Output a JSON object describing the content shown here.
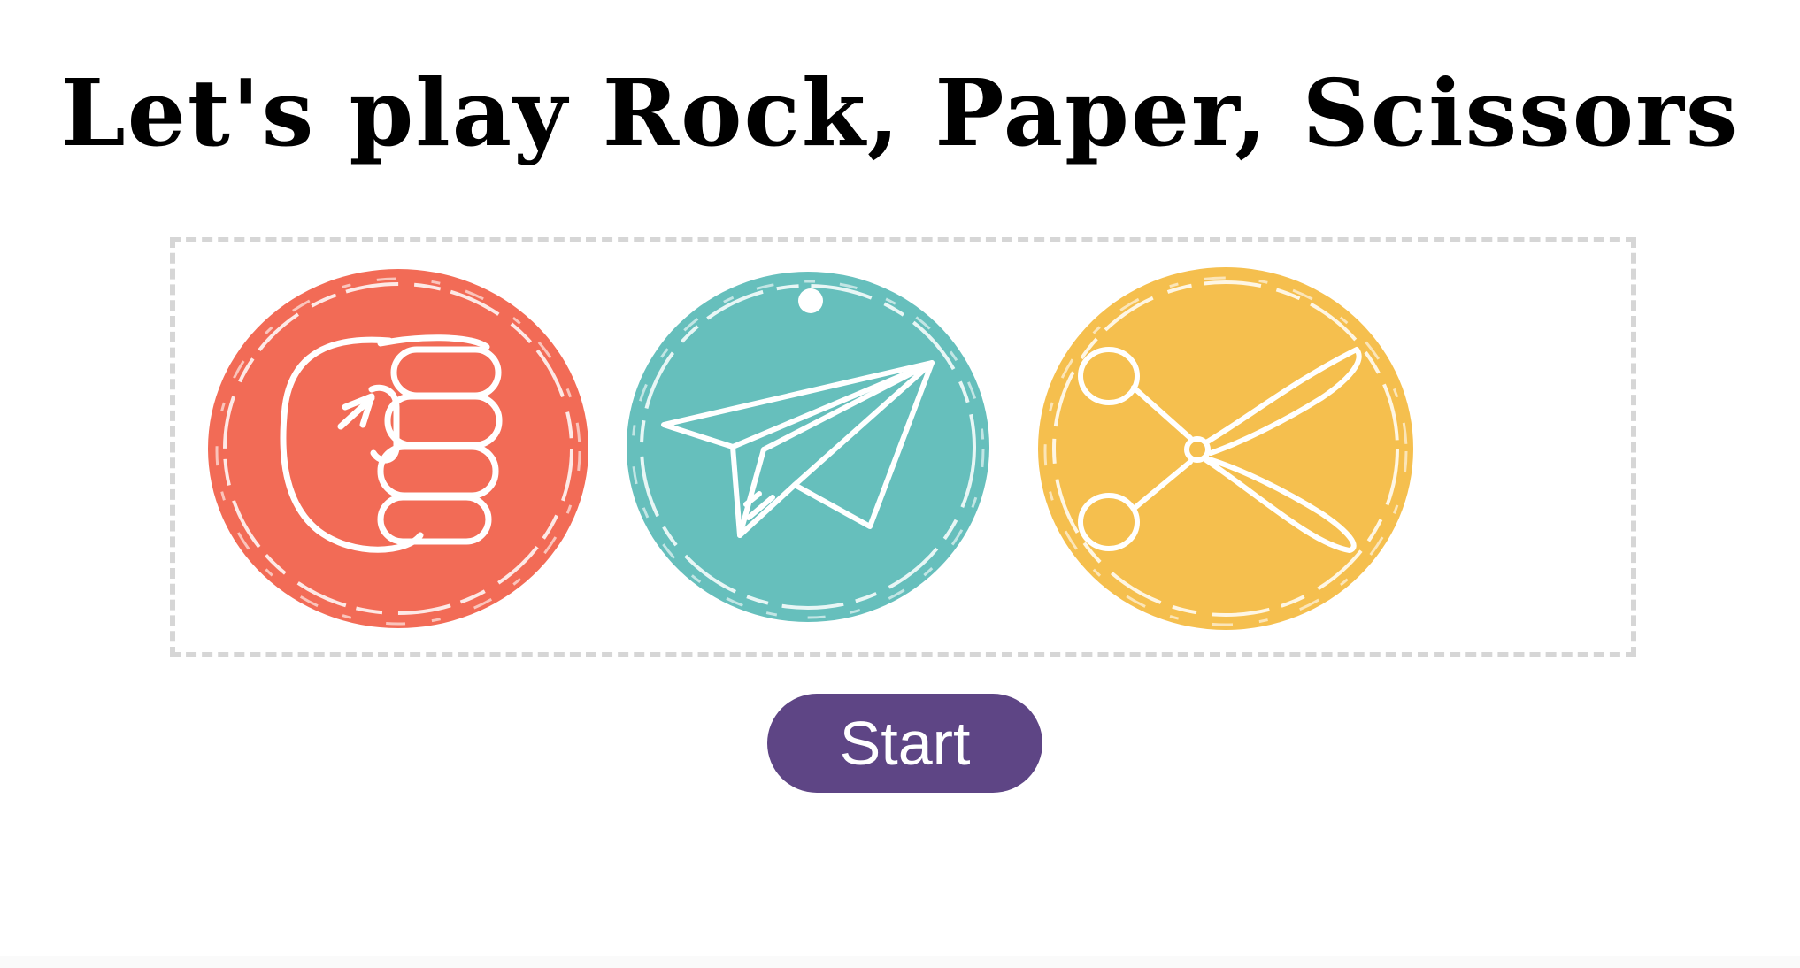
{
  "title": "Let's play Rock, Paper, Scissors",
  "choices": [
    {
      "name": "rock",
      "icon": "rock-fist-icon",
      "color": "#f26b56"
    },
    {
      "name": "paper",
      "icon": "paper-plane-icon",
      "color": "#66bfbc"
    },
    {
      "name": "scissors",
      "icon": "scissors-icon",
      "color": "#f5bf4e"
    }
  ],
  "start_button": {
    "label": "Start",
    "color": "#5e4585"
  }
}
